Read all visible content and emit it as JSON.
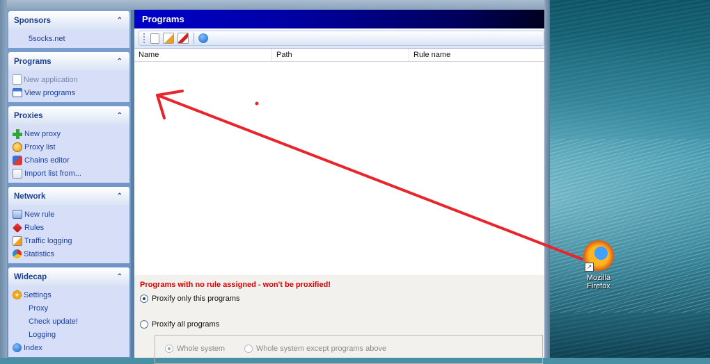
{
  "sidebar": {
    "groups": [
      {
        "title": "Sponsors",
        "items": [
          {
            "label": "5socks.net"
          }
        ]
      },
      {
        "title": "Programs",
        "items": [
          {
            "label": "New application"
          },
          {
            "label": "View programs"
          }
        ]
      },
      {
        "title": "Proxies",
        "items": [
          {
            "label": "New proxy"
          },
          {
            "label": "Proxy list"
          },
          {
            "label": "Chains editor"
          },
          {
            "label": "Import list from..."
          }
        ]
      },
      {
        "title": "Network",
        "items": [
          {
            "label": "New rule"
          },
          {
            "label": "Rules"
          },
          {
            "label": "Traffic logging"
          },
          {
            "label": "Statistics"
          }
        ]
      },
      {
        "title": "Widecap",
        "items": [
          {
            "label": "Settings"
          },
          {
            "label": "Proxy"
          },
          {
            "label": "Check update!"
          },
          {
            "label": "Logging"
          },
          {
            "label": "Index"
          }
        ]
      }
    ]
  },
  "main": {
    "title": "Programs",
    "columns": [
      "Name",
      "Path",
      "Rule name"
    ],
    "warning": "Programs with no rule assigned - won't be proxified!",
    "option_only": "Proxify only this programs",
    "option_all": "Proxify all programs",
    "sub_whole_system": "Whole system",
    "sub_except": "Whole system except programs above"
  },
  "desktop": {
    "icon_label_line1": "Mozilla",
    "icon_label_line2": "Firefox"
  },
  "colors": {
    "title_bar": "#0000cc",
    "warning": "#e00000",
    "annotation": "#e8252b"
  },
  "icons": [
    "new-document-icon",
    "edit-icon",
    "delete-icon",
    "info-icon",
    "firefox-icon",
    "shortcut-arrow-icon"
  ]
}
